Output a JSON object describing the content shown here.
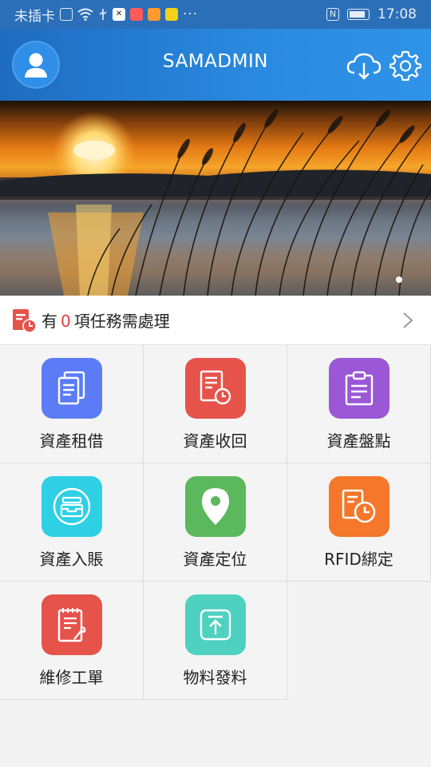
{
  "status_bar": {
    "carrier": "未插卡",
    "dots": "···",
    "nfc": "N",
    "time": "17:08"
  },
  "header": {
    "title": "SAMADMIN"
  },
  "banner": {
    "pages": 1,
    "current_page": 1
  },
  "tasks": {
    "prefix": "有",
    "count": "0",
    "suffix": "項任務需處理"
  },
  "grid": {
    "items": [
      {
        "label": "資產租借",
        "icon": "documents-icon",
        "color": "#5b7cf6"
      },
      {
        "label": "資產收回",
        "icon": "document-clock-icon",
        "color": "#e5534b"
      },
      {
        "label": "資產盤點",
        "icon": "clipboard-icon",
        "color": "#9a57d6"
      },
      {
        "label": "資產入賬",
        "icon": "inbox-tray-icon",
        "color": "#2fd0e4"
      },
      {
        "label": "資產定位",
        "icon": "location-pin-icon",
        "color": "#5cb85c"
      },
      {
        "label": "RFID綁定",
        "icon": "tag-clock-icon",
        "color": "#f4772a"
      },
      {
        "label": "維修工單",
        "icon": "wrench-list-icon",
        "color": "#e5534b"
      },
      {
        "label": "物料發料",
        "icon": "upload-icon",
        "color": "#4fd1c0"
      }
    ]
  }
}
